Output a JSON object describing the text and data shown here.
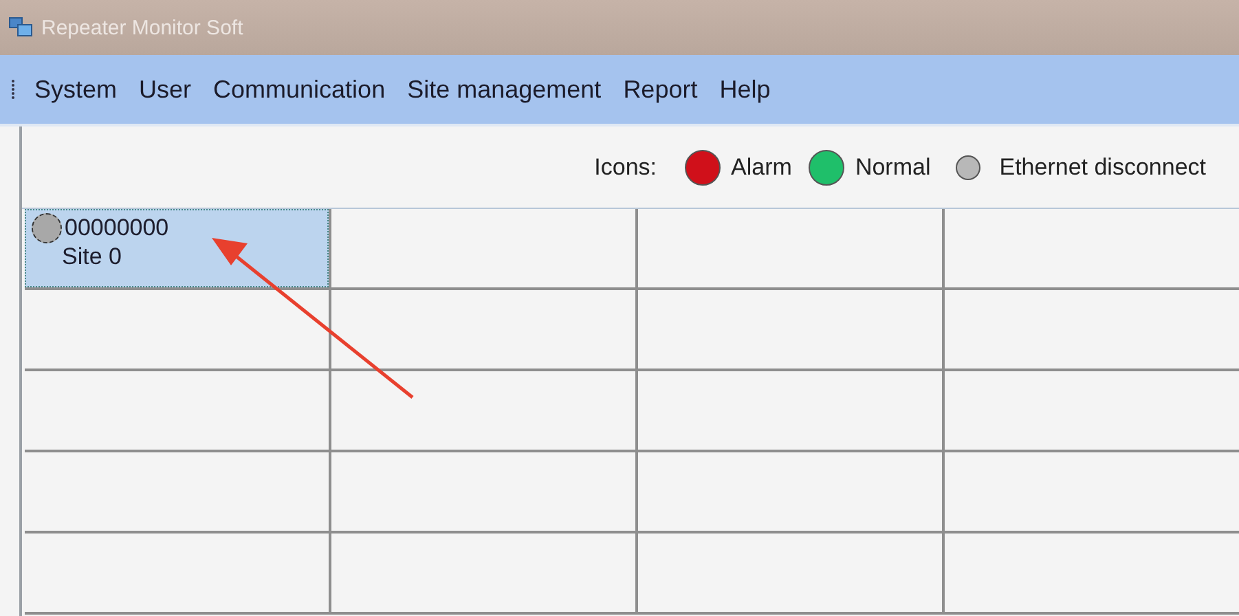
{
  "window": {
    "title": "Repeater Monitor Soft"
  },
  "menu": [
    "System",
    "User",
    "Communication",
    "Site management",
    "Report",
    "Help"
  ],
  "legend": {
    "label": "Icons:",
    "items": [
      {
        "label": "Alarm",
        "color": "#d0101a"
      },
      {
        "label": "Normal",
        "color": "#1fbf6a"
      },
      {
        "label": "Ethernet disconnect",
        "color": "#b8b8b8"
      }
    ]
  },
  "sites": [
    {
      "id": "00000000",
      "name": "Site 0",
      "kind": "disconnected",
      "selected": true
    }
  ]
}
